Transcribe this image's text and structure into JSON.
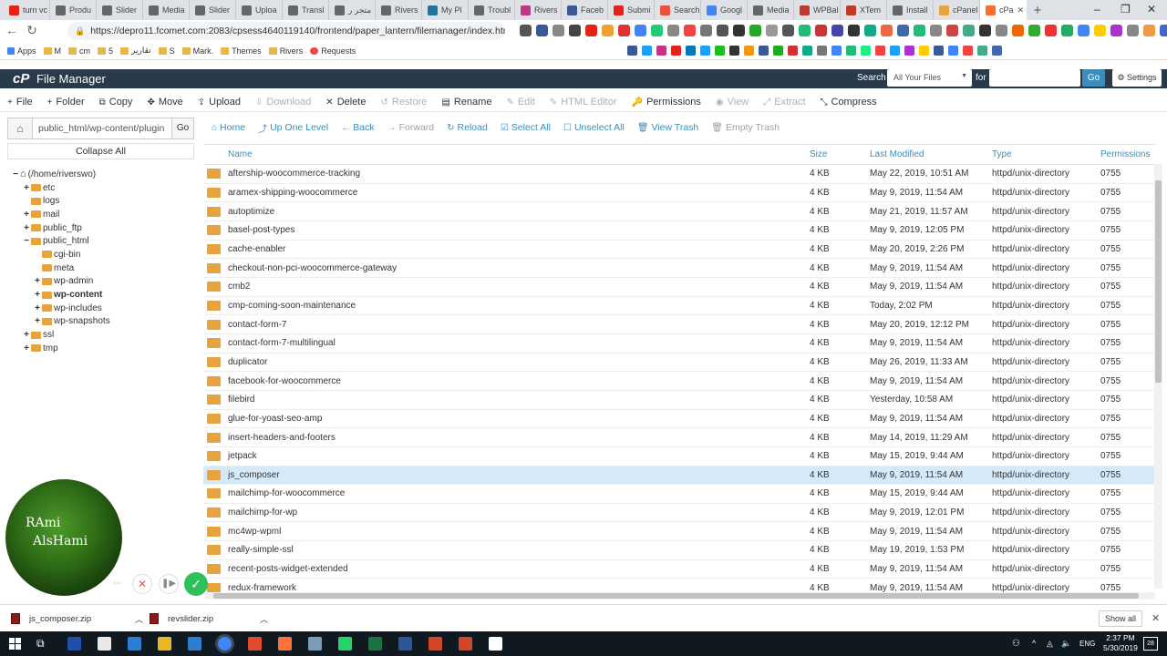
{
  "browser": {
    "tabs": [
      {
        "label": "turn vc",
        "color": "#e62117"
      },
      {
        "label": "Produ",
        "color": "#666666"
      },
      {
        "label": "Slider",
        "color": "#666666"
      },
      {
        "label": "Media",
        "color": "#666666"
      },
      {
        "label": "Slider",
        "color": "#666666"
      },
      {
        "label": "Uploa",
        "color": "#666666"
      },
      {
        "label": "Transl",
        "color": "#666666"
      },
      {
        "label": "متجر ر",
        "color": "#666666"
      },
      {
        "label": "Rivers",
        "color": "#666666"
      },
      {
        "label": "My Pl",
        "color": "#21759b"
      },
      {
        "label": "Troubl",
        "color": "#666666"
      },
      {
        "label": "Rivers",
        "color": "#c13584"
      },
      {
        "label": "Faceb",
        "color": "#3b5998"
      },
      {
        "label": "Submi",
        "color": "#e62117"
      },
      {
        "label": "Search",
        "color": "#e8543b"
      },
      {
        "label": "Googl",
        "color": "#4285f4"
      },
      {
        "label": "Media",
        "color": "#666666"
      },
      {
        "label": "WPBal",
        "color": "#c0392b"
      },
      {
        "label": "XTem",
        "color": "#c0392b"
      },
      {
        "label": "Install",
        "color": "#666666"
      },
      {
        "label": "cPanel",
        "color": "#e8a33d"
      },
      {
        "label": "cPa",
        "color": "#ff6c2c"
      }
    ],
    "new_tab": "+",
    "window_controls": {
      "minimize": "–",
      "maximize": "❐",
      "close": "✕"
    },
    "url": "https://depro11.fcomet.com:2083/cpsess4640119140/frontend/paper_lantern/filemanager/index.html",
    "bookmarks": [
      {
        "label": "Apps",
        "type": "apps"
      },
      {
        "label": "M",
        "type": "folder"
      },
      {
        "label": "cm",
        "type": "folder"
      },
      {
        "label": "5",
        "type": "folder"
      },
      {
        "label": "تقارير",
        "type": "folder"
      },
      {
        "label": "S",
        "type": "folder"
      },
      {
        "label": "Mark.",
        "type": "folder"
      },
      {
        "label": "Themes",
        "type": "folder"
      },
      {
        "label": "Rivers",
        "type": "folder"
      },
      {
        "label": "Requests",
        "type": "icon"
      }
    ]
  },
  "cpanel": {
    "logo": "cP",
    "title": "File Manager",
    "search_label": "Search",
    "search_scope": "All Your Files",
    "for_label": "for",
    "go": "Go",
    "settings": "Settings"
  },
  "toolbar": [
    {
      "icon": "+",
      "label": "File",
      "enabled": true
    },
    {
      "icon": "+",
      "label": "Folder",
      "enabled": true
    },
    {
      "icon": "⧉",
      "label": "Copy",
      "enabled": true
    },
    {
      "icon": "✥",
      "label": "Move",
      "enabled": true
    },
    {
      "icon": "⇪",
      "label": "Upload",
      "enabled": true
    },
    {
      "icon": "⇩",
      "label": "Download",
      "enabled": false
    },
    {
      "icon": "✕",
      "label": "Delete",
      "enabled": true
    },
    {
      "icon": "↺",
      "label": "Restore",
      "enabled": false
    },
    {
      "icon": "▤",
      "label": "Rename",
      "enabled": true
    },
    {
      "icon": "✎",
      "label": "Edit",
      "enabled": false
    },
    {
      "icon": "✎",
      "label": "HTML Editor",
      "enabled": false
    },
    {
      "icon": "🔑",
      "label": "Permissions",
      "enabled": true
    },
    {
      "icon": "◉",
      "label": "View",
      "enabled": false
    },
    {
      "icon": "⤢",
      "label": "Extract",
      "enabled": false
    },
    {
      "icon": "⤡",
      "label": "Compress",
      "enabled": true
    }
  ],
  "left": {
    "path": "public_html/wp-content/plugin",
    "go": "Go",
    "collapse_all": "Collapse All",
    "tree": [
      {
        "label": "(/home/riverswo)",
        "depth": 0,
        "toggle": "−",
        "bold": false,
        "home": true
      },
      {
        "label": "etc",
        "depth": 1,
        "toggle": "+",
        "bold": false
      },
      {
        "label": "logs",
        "depth": 1,
        "toggle": "",
        "bold": false
      },
      {
        "label": "mail",
        "depth": 1,
        "toggle": "+",
        "bold": false
      },
      {
        "label": "public_ftp",
        "depth": 1,
        "toggle": "+",
        "bold": false
      },
      {
        "label": "public_html",
        "depth": 1,
        "toggle": "−",
        "bold": false
      },
      {
        "label": "cgi-bin",
        "depth": 2,
        "toggle": "",
        "bold": false
      },
      {
        "label": "meta",
        "depth": 2,
        "toggle": "",
        "bold": false
      },
      {
        "label": "wp-admin",
        "depth": 2,
        "toggle": "+",
        "bold": false
      },
      {
        "label": "wp-content",
        "depth": 2,
        "toggle": "+",
        "bold": true
      },
      {
        "label": "wp-includes",
        "depth": 2,
        "toggle": "+",
        "bold": false
      },
      {
        "label": "wp-snapshots",
        "depth": 2,
        "toggle": "+",
        "bold": false
      },
      {
        "label": "ssl",
        "depth": 1,
        "toggle": "+",
        "bold": false
      },
      {
        "label": "tmp",
        "depth": 1,
        "toggle": "+",
        "bold": false
      }
    ]
  },
  "right_toolbar": [
    {
      "icon": "⌂",
      "label": "Home",
      "enabled": true
    },
    {
      "icon": "⤴",
      "label": "Up One Level",
      "enabled": true
    },
    {
      "icon": "←",
      "label": "Back",
      "enabled": true
    },
    {
      "icon": "→",
      "label": "Forward",
      "enabled": false
    },
    {
      "icon": "↻",
      "label": "Reload",
      "enabled": true
    },
    {
      "icon": "☑",
      "label": "Select All",
      "enabled": true
    },
    {
      "icon": "☐",
      "label": "Unselect All",
      "enabled": true
    },
    {
      "icon": "🗑",
      "label": "View Trash",
      "enabled": true
    },
    {
      "icon": "🗑",
      "label": "Empty Trash",
      "enabled": false
    }
  ],
  "table": {
    "headers": [
      "Name",
      "Size",
      "Last Modified",
      "Type",
      "Permissions"
    ],
    "rows": [
      {
        "name": "aftership-woocommerce-tracking",
        "size": "4 KB",
        "modified": "May 22, 2019, 10:51 AM",
        "type": "httpd/unix-directory",
        "perm": "0755",
        "selected": false
      },
      {
        "name": "aramex-shipping-woocommerce",
        "size": "4 KB",
        "modified": "May 9, 2019, 11:54 AM",
        "type": "httpd/unix-directory",
        "perm": "0755",
        "selected": false
      },
      {
        "name": "autoptimize",
        "size": "4 KB",
        "modified": "May 21, 2019, 11:57 AM",
        "type": "httpd/unix-directory",
        "perm": "0755",
        "selected": false
      },
      {
        "name": "basel-post-types",
        "size": "4 KB",
        "modified": "May 9, 2019, 12:05 PM",
        "type": "httpd/unix-directory",
        "perm": "0755",
        "selected": false
      },
      {
        "name": "cache-enabler",
        "size": "4 KB",
        "modified": "May 20, 2019, 2:26 PM",
        "type": "httpd/unix-directory",
        "perm": "0755",
        "selected": false
      },
      {
        "name": "checkout-non-pci-woocommerce-gateway",
        "size": "4 KB",
        "modified": "May 9, 2019, 11:54 AM",
        "type": "httpd/unix-directory",
        "perm": "0755",
        "selected": false
      },
      {
        "name": "cmb2",
        "size": "4 KB",
        "modified": "May 9, 2019, 11:54 AM",
        "type": "httpd/unix-directory",
        "perm": "0755",
        "selected": false
      },
      {
        "name": "cmp-coming-soon-maintenance",
        "size": "4 KB",
        "modified": "Today, 2:02 PM",
        "type": "httpd/unix-directory",
        "perm": "0755",
        "selected": false
      },
      {
        "name": "contact-form-7",
        "size": "4 KB",
        "modified": "May 20, 2019, 12:12 PM",
        "type": "httpd/unix-directory",
        "perm": "0755",
        "selected": false
      },
      {
        "name": "contact-form-7-multilingual",
        "size": "4 KB",
        "modified": "May 9, 2019, 11:54 AM",
        "type": "httpd/unix-directory",
        "perm": "0755",
        "selected": false
      },
      {
        "name": "duplicator",
        "size": "4 KB",
        "modified": "May 26, 2019, 11:33 AM",
        "type": "httpd/unix-directory",
        "perm": "0755",
        "selected": false
      },
      {
        "name": "facebook-for-woocommerce",
        "size": "4 KB",
        "modified": "May 9, 2019, 11:54 AM",
        "type": "httpd/unix-directory",
        "perm": "0755",
        "selected": false
      },
      {
        "name": "filebird",
        "size": "4 KB",
        "modified": "Yesterday, 10:58 AM",
        "type": "httpd/unix-directory",
        "perm": "0755",
        "selected": false
      },
      {
        "name": "glue-for-yoast-seo-amp",
        "size": "4 KB",
        "modified": "May 9, 2019, 11:54 AM",
        "type": "httpd/unix-directory",
        "perm": "0755",
        "selected": false
      },
      {
        "name": "insert-headers-and-footers",
        "size": "4 KB",
        "modified": "May 14, 2019, 11:29 AM",
        "type": "httpd/unix-directory",
        "perm": "0755",
        "selected": false
      },
      {
        "name": "jetpack",
        "size": "4 KB",
        "modified": "May 15, 2019, 9:44 AM",
        "type": "httpd/unix-directory",
        "perm": "0755",
        "selected": false
      },
      {
        "name": "js_composer",
        "size": "4 KB",
        "modified": "May 9, 2019, 11:54 AM",
        "type": "httpd/unix-directory",
        "perm": "0755",
        "selected": true
      },
      {
        "name": "mailchimp-for-woocommerce",
        "size": "4 KB",
        "modified": "May 15, 2019, 9:44 AM",
        "type": "httpd/unix-directory",
        "perm": "0755",
        "selected": false
      },
      {
        "name": "mailchimp-for-wp",
        "size": "4 KB",
        "modified": "May 9, 2019, 12:01 PM",
        "type": "httpd/unix-directory",
        "perm": "0755",
        "selected": false
      },
      {
        "name": "mc4wp-wpml",
        "size": "4 KB",
        "modified": "May 9, 2019, 11:54 AM",
        "type": "httpd/unix-directory",
        "perm": "0755",
        "selected": false
      },
      {
        "name": "really-simple-ssl",
        "size": "4 KB",
        "modified": "May 19, 2019, 1:53 PM",
        "type": "httpd/unix-directory",
        "perm": "0755",
        "selected": false
      },
      {
        "name": "recent-posts-widget-extended",
        "size": "4 KB",
        "modified": "May 9, 2019, 11:54 AM",
        "type": "httpd/unix-directory",
        "perm": "0755",
        "selected": false
      },
      {
        "name": "redux-framework",
        "size": "4 KB",
        "modified": "May 9, 2019, 11:54 AM",
        "type": "httpd/unix-directory",
        "perm": "0755",
        "selected": false
      }
    ]
  },
  "overlay": {
    "name_line1": "RAmi",
    "name_line2": "AlsHami"
  },
  "downloads": {
    "items": [
      "js_composer.zip",
      "revslider.zip"
    ],
    "show_all": "Show all",
    "close": "✕"
  },
  "taskbar": {
    "language": "ENG",
    "time": "2:37 PM",
    "date": "5/30/2019",
    "notifications": "28"
  }
}
